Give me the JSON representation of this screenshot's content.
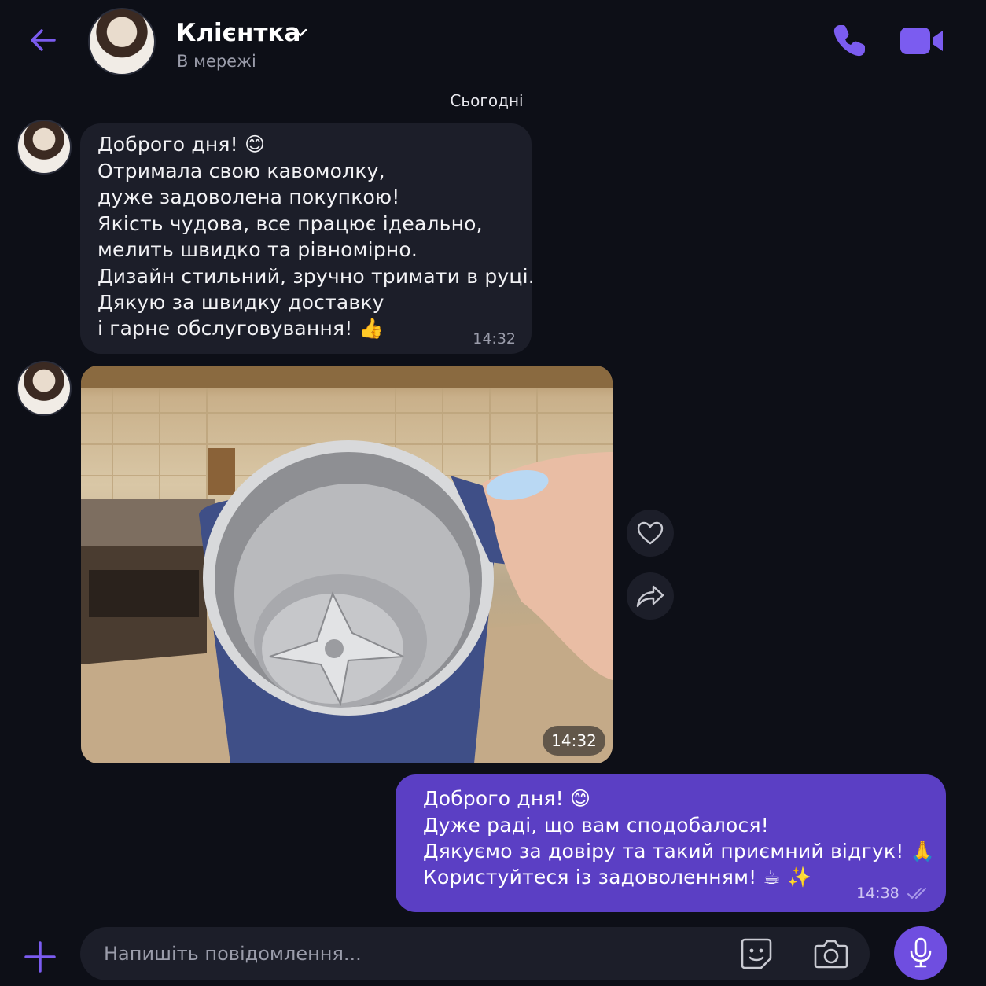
{
  "colors": {
    "accent": "#7b5cf0",
    "background": "#0d0f17",
    "incoming_bubble": "#1c1e29",
    "outgoing_bubble": "#5b3fc4"
  },
  "header": {
    "contact_name": "Клієнтка",
    "status": "В мережі",
    "icons": [
      "back-arrow-icon",
      "chevron-down-icon",
      "phone-icon",
      "video-camera-icon"
    ]
  },
  "chat": {
    "date_separator": "Сьогодні",
    "incoming_message": {
      "lines": [
        "Доброго дня! 😊",
        "Отримала свою кавомолку,",
        "дуже задоволена покупкою!",
        "Якість чудова, все працює ідеально,",
        "мелить швидко та рівномірно.",
        "Дизайн стильний, зручно тримати в руці.",
        "Дякую за швидку доставку",
        "і гарне обслуговування! 👍"
      ],
      "time": "14:32"
    },
    "photo_message": {
      "time": "14:32",
      "actions": [
        "heart-icon",
        "share-icon"
      ]
    },
    "outgoing_message": {
      "lines": [
        "Доброго дня! 😊",
        "Дуже раді, що вам сподобалося!",
        "Дякуємо за довіру та такий приємний відгук! 🙏",
        "Користуйтеся із задоволенням! ☕ ✨"
      ],
      "time": "14:38",
      "status_icon": "double-check-icon"
    }
  },
  "composer": {
    "placeholder": "Напишіть повідомлення...",
    "icons": [
      "plus-icon",
      "sticker-icon",
      "camera-icon",
      "microphone-icon"
    ]
  }
}
